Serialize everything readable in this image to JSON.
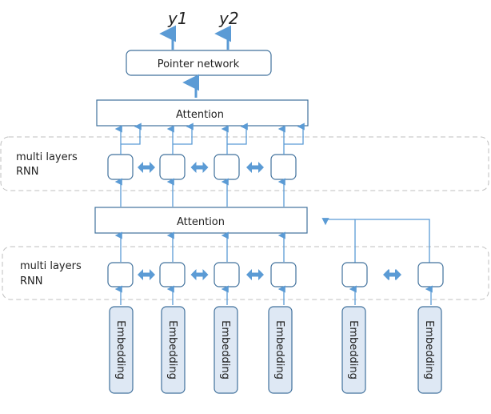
{
  "outputs": [
    "y1",
    "y2"
  ],
  "pointer_network": {
    "label": "Pointer network"
  },
  "attention_top": {
    "label": "Attention"
  },
  "attention_bottom": {
    "label": "Attention"
  },
  "rnn_top_group": {
    "label_line1": "multi layers",
    "label_line2": "RNN",
    "cell_count": 4
  },
  "rnn_bottom_group": {
    "label_line1": "multi layers",
    "label_line2": "RNN",
    "cell_count": 6
  },
  "embeddings": [
    "Embedding",
    "Embedding",
    "Embedding",
    "Embedding",
    "Embedding",
    "Embedding"
  ],
  "colors": {
    "arrow": "#5b9bd5",
    "box_stroke": "#41719c",
    "embedding_fill": "#dee8f4",
    "dashed_group": "#bfbfbf"
  }
}
